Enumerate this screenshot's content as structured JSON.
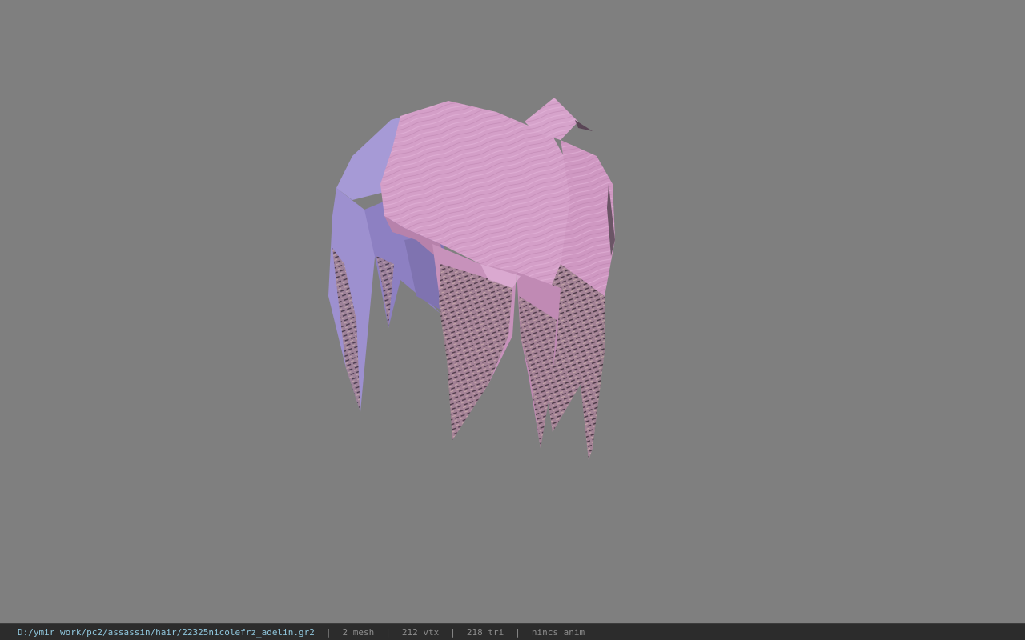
{
  "viewport": {
    "background_color": "#7f7f7f",
    "model": {
      "icon": "hair-mesh-render",
      "colors": {
        "pink_light": "#d9a3cc",
        "pink_mid": "#c48ab6",
        "pink_dark": "#a87399",
        "lavender": "#a69ad6",
        "lavender_dark": "#7f73b0",
        "tips_dark": "#4b3b47"
      }
    }
  },
  "statusbar": {
    "file_path": "D:/ymir work/pc2/assassin/hair/22325nicolefrz_adelin.gr2",
    "separator": "|",
    "mesh_count": "2 mesh",
    "vertex_count": "212 vtx",
    "triangle_count": "218 tri",
    "animation": "nincs anim",
    "colors": {
      "background": "#2c2c2c",
      "path": "#8fc6dc",
      "text": "#8c8c8c"
    }
  }
}
